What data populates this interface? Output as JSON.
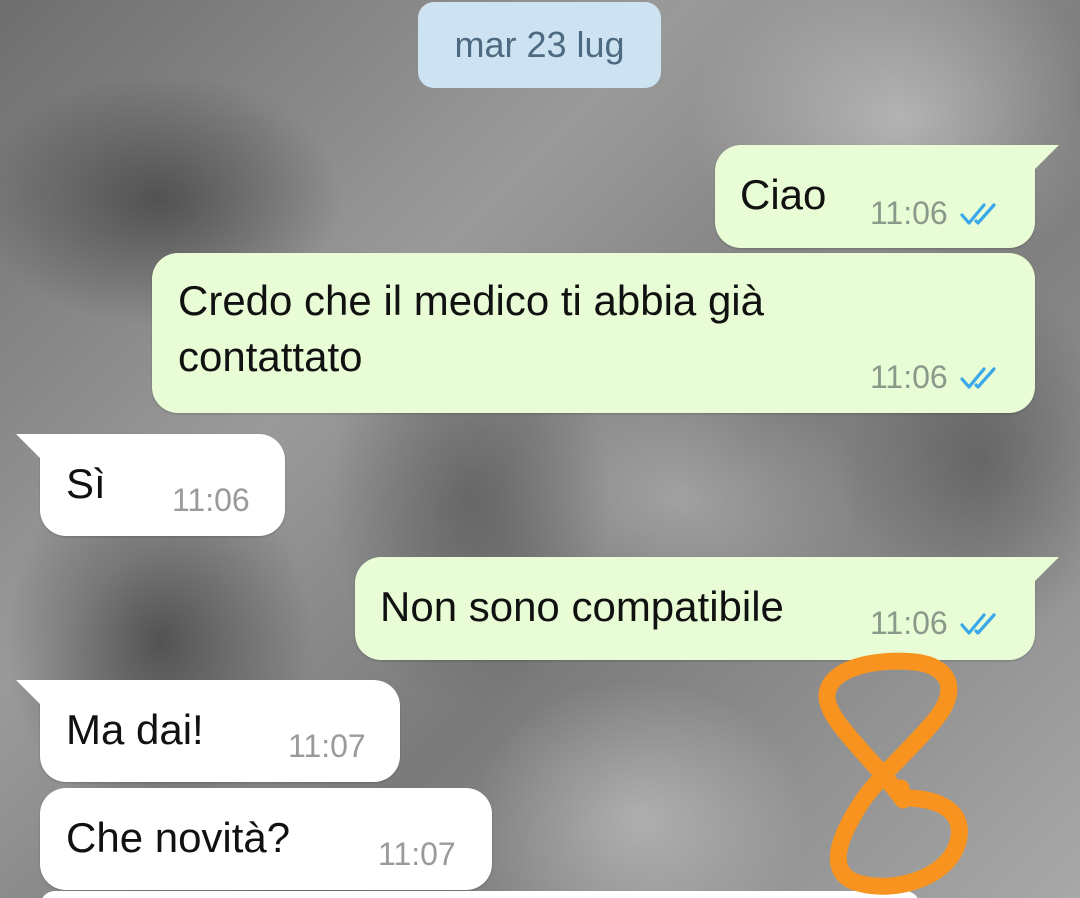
{
  "chat": {
    "date_separator": "mar 23 lug",
    "messages": [
      {
        "direction": "outgoing",
        "text": "Ciao",
        "time": "11:06",
        "status": "read"
      },
      {
        "direction": "outgoing",
        "text": "Credo che il medico ti abbia già\ncontattato",
        "time": "11:06",
        "status": "read"
      },
      {
        "direction": "incoming",
        "text": "Sì",
        "time": "11:06"
      },
      {
        "direction": "outgoing",
        "text": "Non sono compatibile",
        "time": "11:06",
        "status": "read"
      },
      {
        "direction": "incoming",
        "text": "Ma dai!",
        "time": "11:07"
      },
      {
        "direction": "incoming",
        "text": "Che novità?",
        "time": "11:07"
      }
    ]
  },
  "icons": {
    "read_receipt": "double-check-icon",
    "annotation": "orange-handwritten-mark"
  },
  "colors": {
    "outgoing_bubble": "#e8fcd6",
    "incoming_bubble": "#ffffff",
    "date_chip": "#cde3f2",
    "read_checks": "#3aa8e8",
    "annotation": "#f7931e"
  }
}
